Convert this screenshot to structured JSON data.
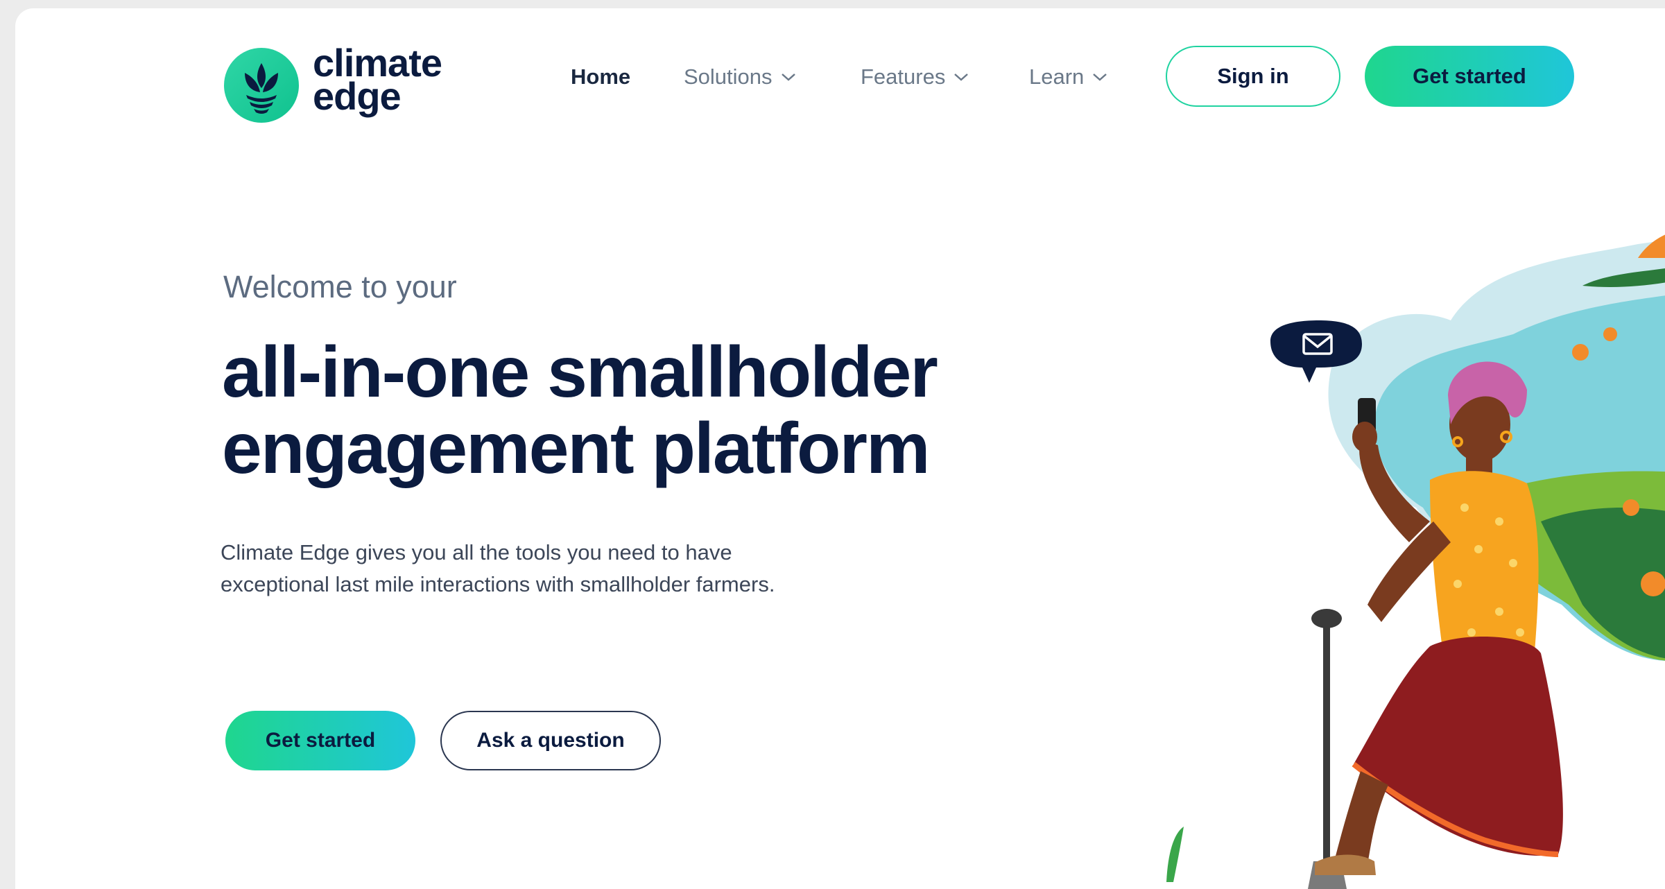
{
  "brand": {
    "line1": "climate",
    "line2": "edge"
  },
  "nav": {
    "items": [
      {
        "label": "Home"
      },
      {
        "label": "Solutions"
      },
      {
        "label": "Features"
      },
      {
        "label": "Learn"
      }
    ],
    "sign_in": "Sign in",
    "get_started": "Get started"
  },
  "hero": {
    "welcome": "Welcome to your",
    "headline_line1": "all-in-one smallholder",
    "headline_line2": "engagement platform",
    "desc_line1": "Climate Edge gives you all the tools you need to have",
    "desc_line2": "exceptional last mile interactions with smallholder farmers.",
    "cta_primary": "Get started",
    "cta_secondary": "Ask a question"
  },
  "colors": {
    "accent_green": "#1fd68e",
    "accent_cyan": "#1fc6d9",
    "navy": "#0b1b3f"
  },
  "icons": [
    "plant-logo-icon",
    "chevron-down-icon",
    "envelope-icon"
  ]
}
